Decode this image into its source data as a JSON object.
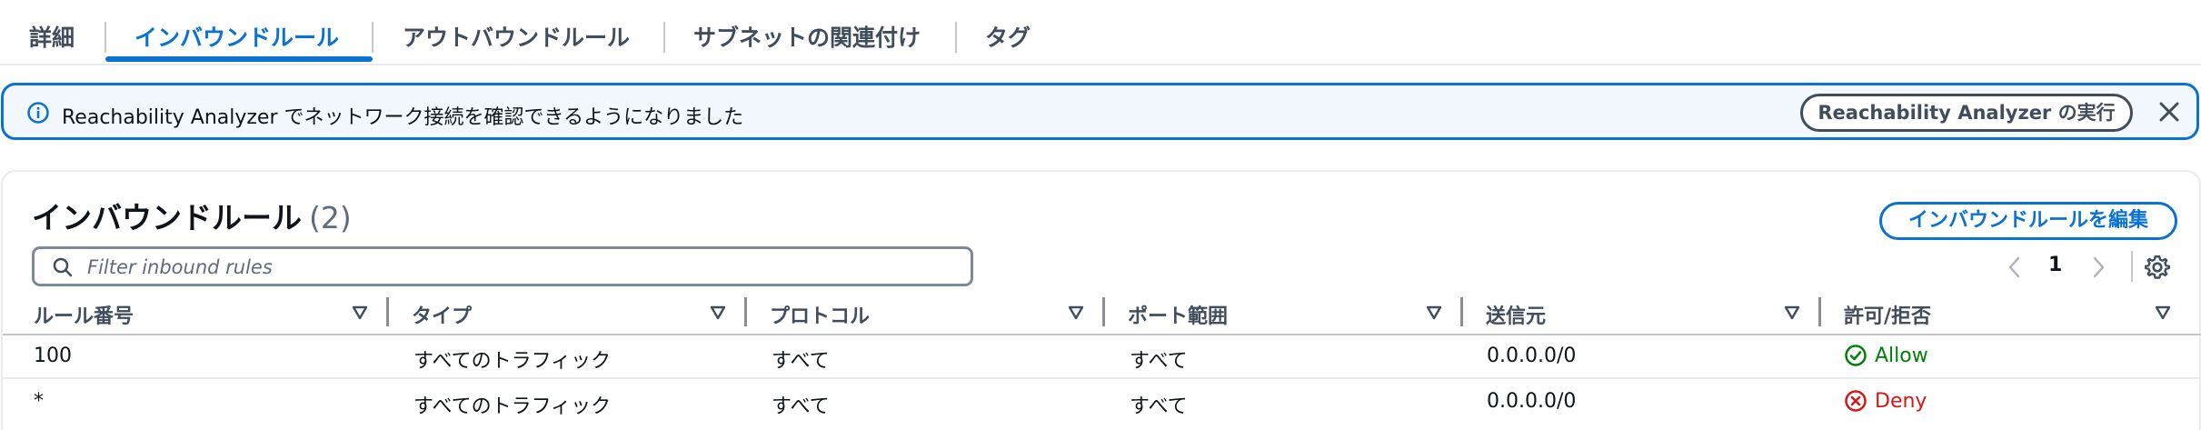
{
  "tabs": [
    {
      "label": "詳細"
    },
    {
      "label": "インバウンドルール",
      "active": true
    },
    {
      "label": "アウトバウンドルール"
    },
    {
      "label": "サブネットの関連付け"
    },
    {
      "label": "タグ"
    }
  ],
  "banner": {
    "text": "Reachability Analyzer でネットワーク接続を確認できるようになりました",
    "button_label": "Reachability Analyzer の実行",
    "icon": "info-icon",
    "close_icon": "close-icon"
  },
  "panel": {
    "title": "インバウンドルール",
    "count": "(2)",
    "edit_button_label": "インバウンドルールを編集"
  },
  "filter": {
    "placeholder": "Filter inbound rules",
    "value": ""
  },
  "pagination": {
    "current_page": "1"
  },
  "table": {
    "columns": [
      "ルール番号",
      "タイプ",
      "プロトコル",
      "ポート範囲",
      "送信元",
      "許可/拒否"
    ],
    "rows": [
      {
        "rule_number": "100",
        "type": "すべてのトラフィック",
        "protocol": "すべて",
        "port_range": "すべて",
        "source": "0.0.0.0/0",
        "action": "Allow"
      },
      {
        "rule_number": "*",
        "type": "すべてのトラフィック",
        "protocol": "すべて",
        "port_range": "すべて",
        "source": "0.0.0.0/0",
        "action": "Deny"
      }
    ]
  },
  "colors": {
    "accent": "#0972d3",
    "banner_bg": "#f2f8fd",
    "allow": "#037f0c",
    "deny": "#d91515"
  }
}
